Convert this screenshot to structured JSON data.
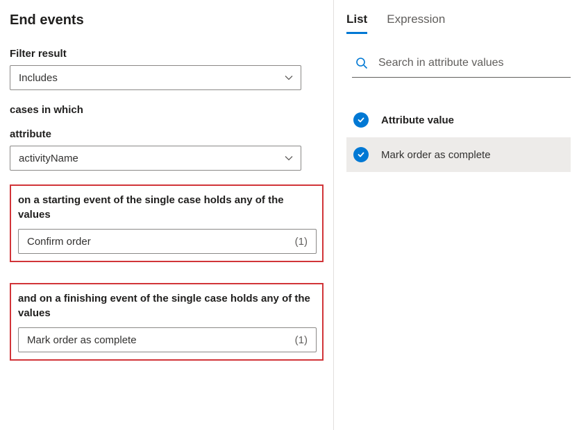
{
  "page": {
    "title": "End events"
  },
  "filterResult": {
    "label": "Filter result",
    "value": "Includes"
  },
  "casesText": "cases in which",
  "attribute": {
    "label": "attribute",
    "value": "activityName"
  },
  "startingEvent": {
    "label": "on a starting event of the single case holds any of the values",
    "value": "Confirm order",
    "count": "(1)"
  },
  "finishingEvent": {
    "label": "and on a finishing event of the single case holds any of the values",
    "value": "Mark order as complete",
    "count": "(1)"
  },
  "tabs": {
    "list": "List",
    "expression": "Expression"
  },
  "search": {
    "placeholder": "Search in attribute values"
  },
  "attrList": {
    "header": "Attribute value",
    "item": "Mark order as complete"
  }
}
